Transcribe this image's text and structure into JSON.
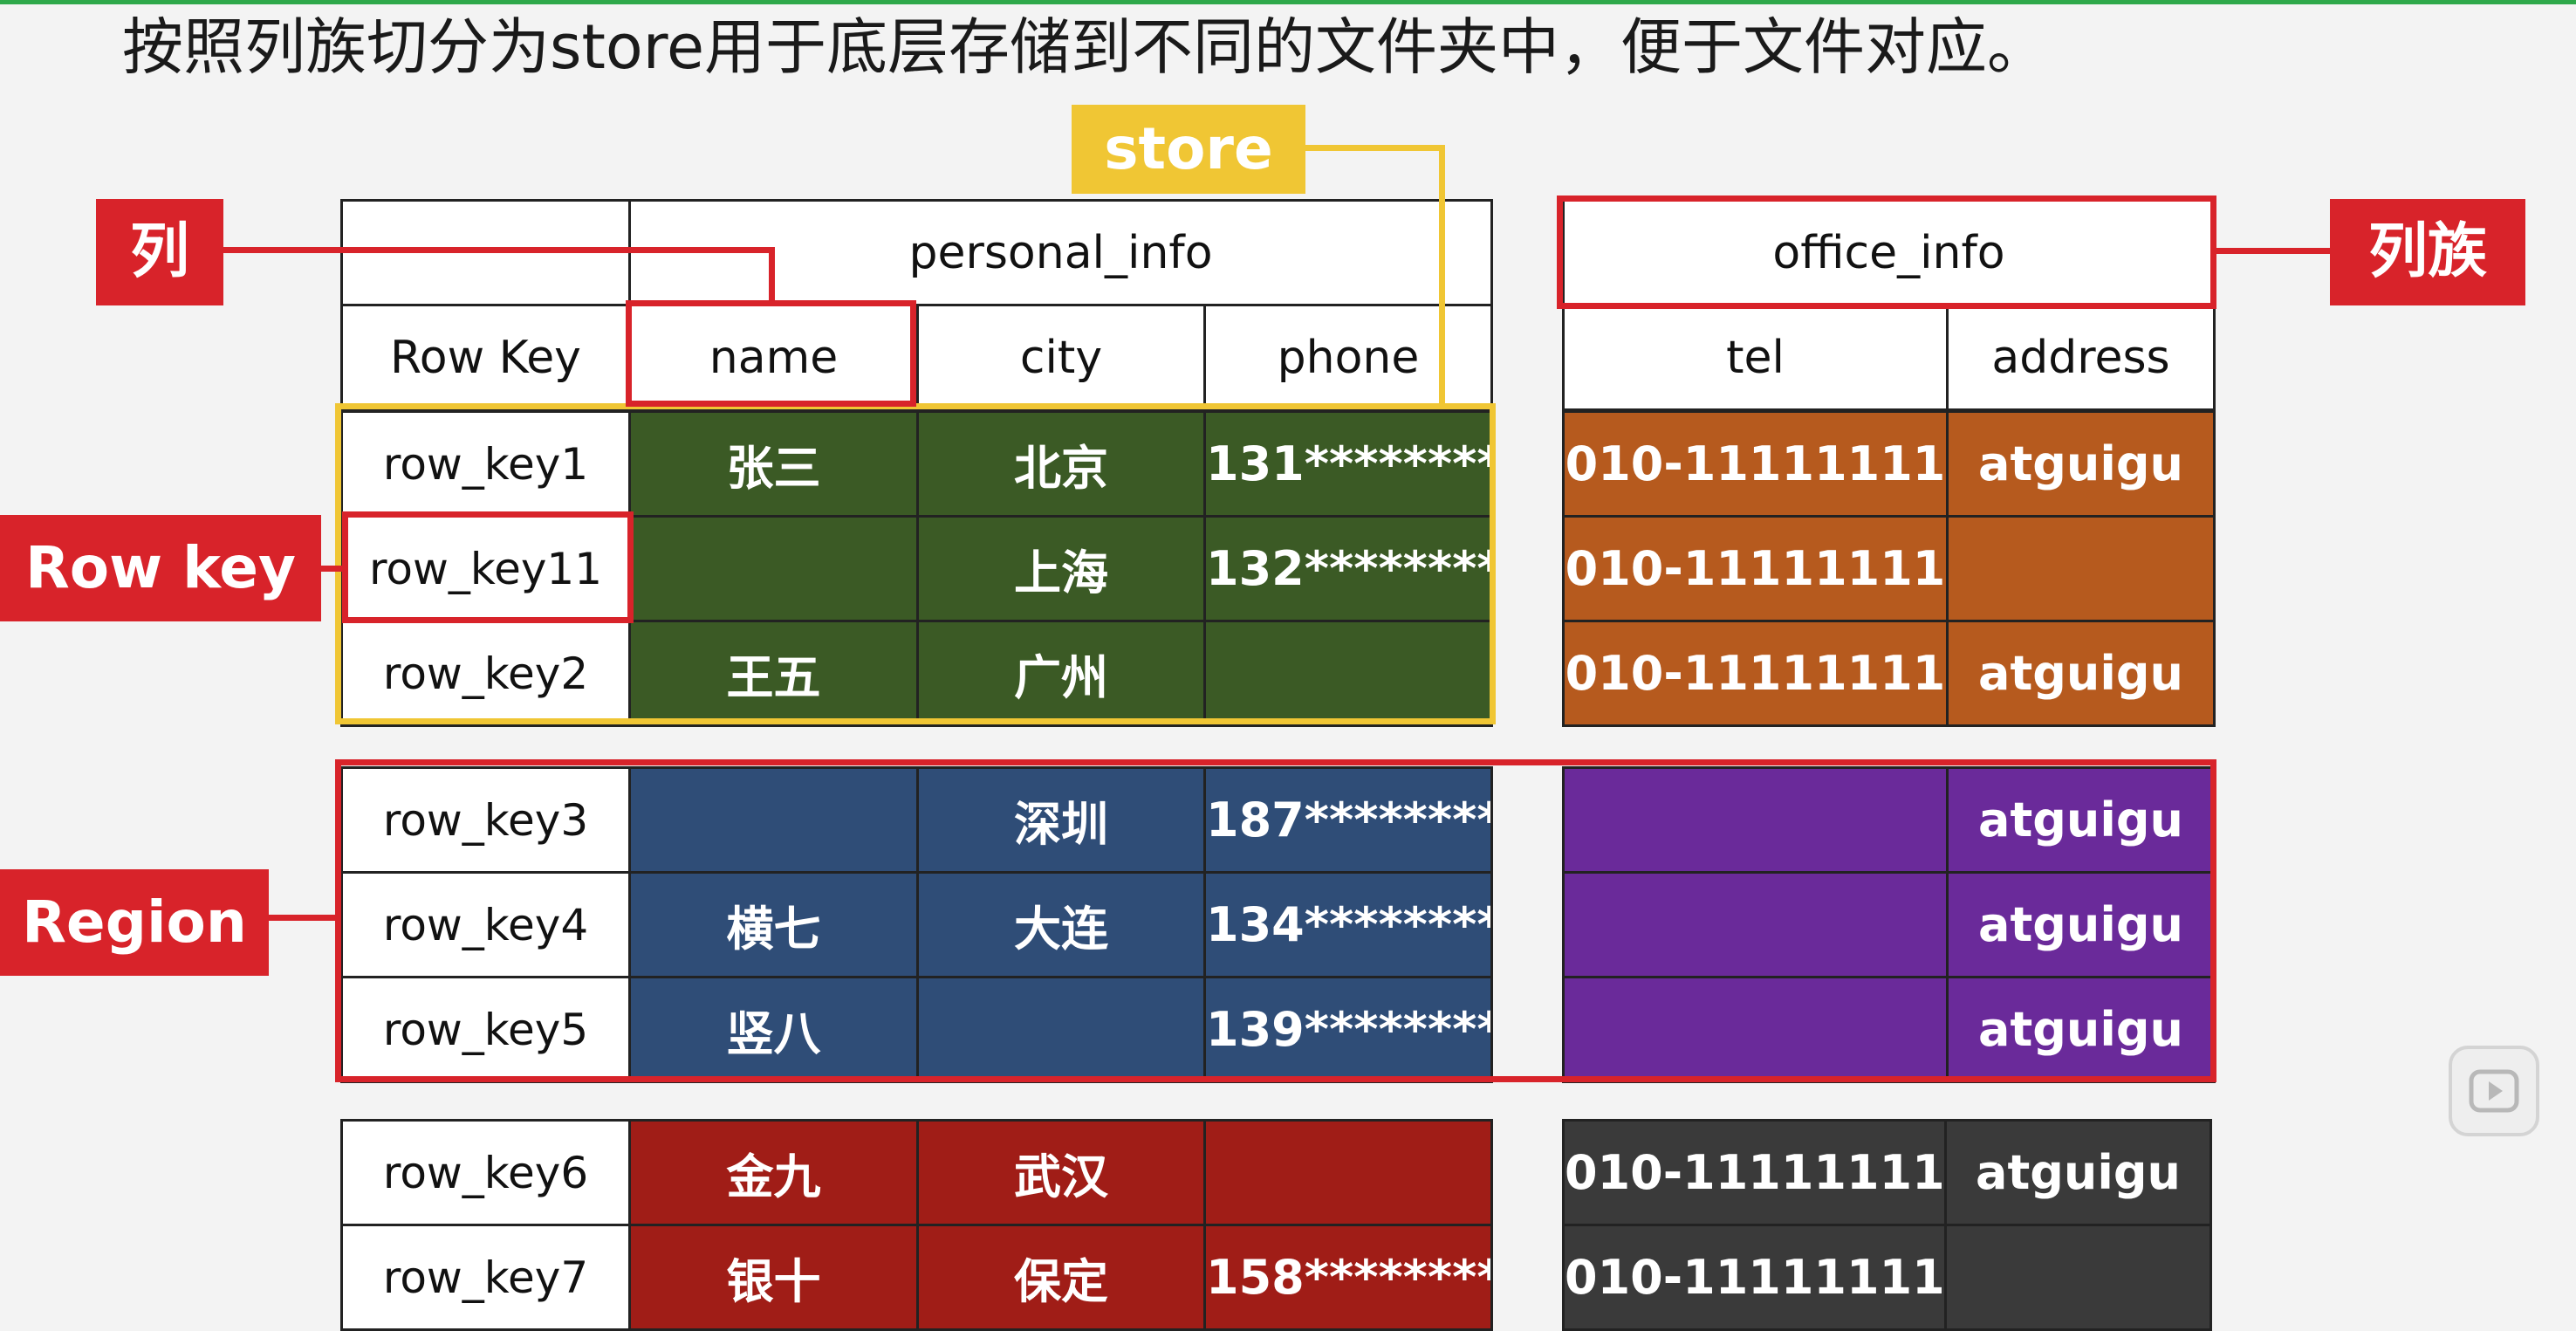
{
  "title": "按照列族切分为store用于底层存储到不同的文件夹中，便于文件对应。",
  "labels": {
    "col": "列",
    "colfam": "列族",
    "rowkey": "Row key",
    "region": "Region",
    "store": "store"
  },
  "left_table": {
    "row_key_header": "Row Key",
    "family": "personal_info",
    "columns": [
      "name",
      "city",
      "phone"
    ],
    "rows": [
      {
        "key": "row_key1",
        "name": "张三",
        "city": "北京",
        "phone": "131********"
      },
      {
        "key": "row_key11",
        "name": "",
        "city": "上海",
        "phone": "132********"
      },
      {
        "key": "row_key2",
        "name": "王五",
        "city": "广州",
        "phone": ""
      },
      {
        "key": "row_key3",
        "name": "",
        "city": "深圳",
        "phone": "187********"
      },
      {
        "key": "row_key4",
        "name": "横七",
        "city": "大连",
        "phone": "134********"
      },
      {
        "key": "row_key5",
        "name": "竖八",
        "city": "",
        "phone": "139********"
      },
      {
        "key": "row_key6",
        "name": "金九",
        "city": "武汉",
        "phone": ""
      },
      {
        "key": "row_key7",
        "name": "银十",
        "city": "保定",
        "phone": "158********"
      }
    ]
  },
  "right_table": {
    "family": "office_info",
    "columns": [
      "tel",
      "address"
    ],
    "rows": [
      {
        "tel": "010-11111111",
        "address": "atguigu"
      },
      {
        "tel": "010-11111111",
        "address": ""
      },
      {
        "tel": "010-11111111",
        "address": "atguigu"
      },
      {
        "tel": "",
        "address": "atguigu"
      },
      {
        "tel": "",
        "address": "atguigu"
      },
      {
        "tel": "",
        "address": "atguigu"
      },
      {
        "tel": "010-11111111",
        "address": "atguigu"
      },
      {
        "tel": "010-11111111",
        "address": ""
      }
    ]
  },
  "colors": {
    "accent_red": "#d8232a",
    "accent_yellow": "#f0c634",
    "group1_left": "#3b5a25",
    "group1_right": "#b65a1e",
    "group2_left": "#2f4d77",
    "group2_right": "#6a2a9a",
    "group3_left": "#a01d17",
    "group3_right": "#3a3a3a"
  },
  "icons": {
    "video": "play-icon"
  }
}
